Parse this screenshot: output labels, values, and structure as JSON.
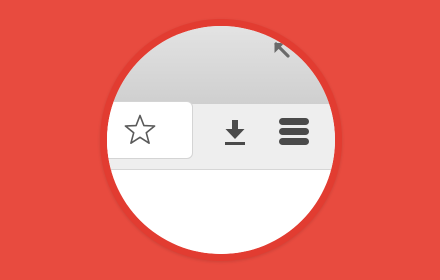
{
  "colors": {
    "background": "#e84b3f",
    "lens_ring": "#e23c31",
    "titlebar": "#d9d9d9",
    "toolbar": "#eeeeee",
    "icon": "#4a4a4a"
  },
  "icons": {
    "restore": "restore-down-arrow-icon",
    "bookmark": "star-icon",
    "download": "download-icon",
    "menu": "hamburger-menu-icon"
  },
  "omnibox": {
    "value": ""
  }
}
